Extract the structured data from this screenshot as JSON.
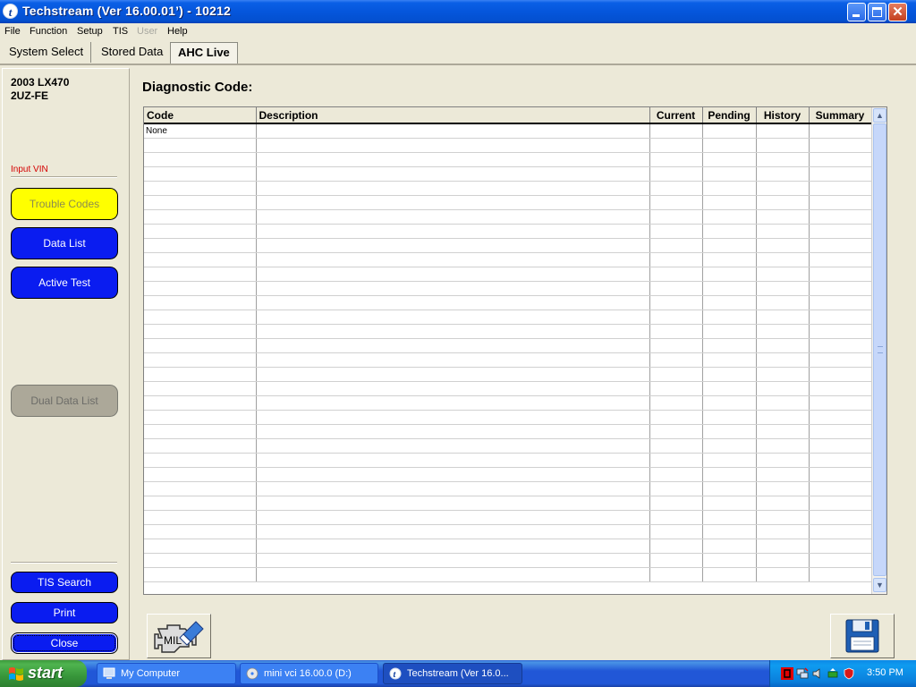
{
  "window": {
    "title": "Techstream (Ver 16.00.01’) - 10212"
  },
  "menu": [
    {
      "label": "File",
      "enabled": true
    },
    {
      "label": "Function",
      "enabled": true
    },
    {
      "label": "Setup",
      "enabled": true
    },
    {
      "label": "TIS",
      "enabled": true
    },
    {
      "label": "User",
      "enabled": false
    },
    {
      "label": "Help",
      "enabled": true
    }
  ],
  "tabs": [
    {
      "label": "System Select",
      "active": false
    },
    {
      "label": "Stored Data",
      "active": false
    },
    {
      "label": "AHC Live",
      "active": true
    }
  ],
  "sidebar": {
    "vehicle_line1": "2003 LX470",
    "vehicle_line2": "2UZ-FE",
    "input_vin": "Input VIN",
    "buttons": {
      "trouble_codes": "Trouble Codes",
      "data_list": "Data List",
      "active_test": "Active Test",
      "dual_data_list": "Dual Data List",
      "tis_search": "TIS Search",
      "print": "Print",
      "close": "Close"
    }
  },
  "main": {
    "title": "Diagnostic Code:",
    "table": {
      "columns": [
        "Code",
        "Description",
        "Current",
        "Pending",
        "History",
        "Summary"
      ],
      "rows": [
        [
          "None",
          "",
          "",
          "",
          "",
          ""
        ]
      ],
      "visible_row_count": 32
    }
  },
  "icons": {
    "mil_label": "MIL"
  },
  "taskbar": {
    "start_label": "start",
    "tasks": [
      {
        "label": "My Computer",
        "icon": "my-computer-icon",
        "active": false
      },
      {
        "label": "mini vci 16.00.0 (D:)",
        "icon": "cd-drive-icon",
        "active": false
      },
      {
        "label": "Techstream (Ver 16.0...",
        "icon": "techstream-icon",
        "active": true
      }
    ],
    "clock": "3:50 PM"
  },
  "colors": {
    "title_blue": "#0556dc",
    "sidebar_blue_button": "#0a1cf0",
    "trouble_codes_yellow": "#ffff00",
    "disabled_gray": "#aca899",
    "input_vin_red": "#d40000",
    "start_green": "#37963a"
  }
}
